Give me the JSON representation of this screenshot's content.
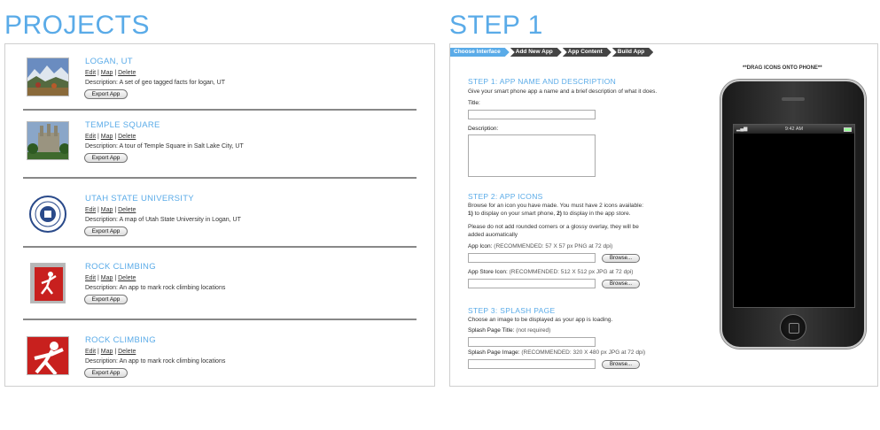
{
  "projects_title": "PROJECTS",
  "step_title": "STEP 1",
  "projects": [
    {
      "name": "LOGAN, UT",
      "edit": "Edit",
      "map": "Map",
      "delete": "Delete",
      "description": "Description:  A set of geo tagged facts for logan, UT",
      "export": "Export App",
      "thumb": "mountain-landscape"
    },
    {
      "name": "TEMPLE SQUARE",
      "edit": "Edit",
      "map": "Map",
      "delete": "Delete",
      "description": "Description:  A tour of Temple Square in Salt Lake City, UT",
      "export": "Export App",
      "thumb": "temple-building"
    },
    {
      "name": "UTAH STATE UNIVERSITY",
      "edit": "Edit",
      "map": "Map",
      "delete": "Delete",
      "description": "Description:  A map of Utah State University in Logan, UT",
      "export": "Export App",
      "thumb": "university-seal"
    },
    {
      "name": "ROCK CLIMBING",
      "edit": "Edit",
      "map": "Map",
      "delete": "Delete",
      "description": "Description:  An app to mark rock climbing locations",
      "export": "Export App",
      "thumb": "climber-red"
    },
    {
      "name": "ROCK CLIMBING",
      "edit": "Edit",
      "map": "Map",
      "delete": "Delete",
      "description": "Description:  An app to mark rock climbing locations",
      "export": "Export App",
      "thumb": "climber-red-large"
    }
  ],
  "breadcrumbs": [
    "Choose Interface",
    "Add New App",
    "App Content",
    "Build App"
  ],
  "builder": {
    "step1_title": "STEP 1: APP NAME AND DESCRIPTION",
    "step1_intro": "Give your smart phone app a name and a brief description of what it does.",
    "title_label": "Title:",
    "title_value": "",
    "description_label": "Description:",
    "description_value": "",
    "step2_title": "STEP 2: APP ICONS",
    "step2_intro_1": "Browse for an icon you have made. You must have 2 icons available:",
    "step2_intro_2a": "1)",
    "step2_intro_2b": " to display on your smart phone, ",
    "step2_intro_2c": "2)",
    "step2_intro_2d": " to display in the app store.",
    "step2_note_1": "Please do not add rounded corners or a glossy overlay, they will be",
    "step2_note_2": "added auomatically",
    "app_icon_label": "App Icon:",
    "app_icon_hint": " (RECOMMENDED: 57 X 57 px PNG at 72 dpi)",
    "store_icon_label": "App Store Icon:",
    "store_icon_hint": " (RECOMMENDED: 512 X 512 px JPG at 72 dpi)",
    "browse": "Browse...",
    "step3_title": "STEP 3: SPLASH PAGE",
    "step3_intro": "Choose an image to be displayed as your app is loading.",
    "splash_title_label": "Splash Page Title:",
    "splash_title_hint": " (not required)",
    "splash_image_label": "Splash Page Image:",
    "splash_image_hint": " (RECOMMENDED: 320 X 480 px JPG at 72 dpi)"
  },
  "phone": {
    "drag_hint": "**DRAG ICONS ONTO PHONE**",
    "time": "9:42 AM",
    "signal": "▂▄▆"
  },
  "colors": {
    "accent": "#5aabe8",
    "crumb_dark": "#444444"
  }
}
